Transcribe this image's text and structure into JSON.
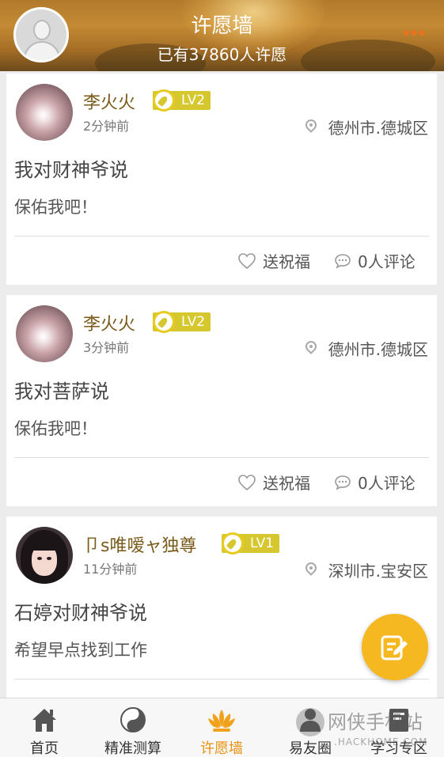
{
  "header": {
    "title": "许愿墙",
    "subtitle": "已有37860人许愿"
  },
  "posts": [
    {
      "user": "李火火",
      "level": "LV2",
      "time": "2分钟前",
      "location": "德州市.德城区",
      "title": "我对财神爷说",
      "content": "保佑我吧！",
      "bless_label": "送祝福",
      "comments_label": "0人评论"
    },
    {
      "user": "李火火",
      "level": "LV2",
      "time": "3分钟前",
      "location": "德州市.德城区",
      "title": "我对菩萨说",
      "content": "保佑我吧！",
      "bless_label": "送祝福",
      "comments_label": "0人评论"
    },
    {
      "user": "卩s唯嗳ャ独尊",
      "level": "LV1",
      "time": "11分钟前",
      "location": "深圳市.宝安区",
      "title": "石婷对财神爷说",
      "content": "希望早点找到工作"
    }
  ],
  "nav": [
    {
      "label": "首页",
      "icon": "home-icon"
    },
    {
      "label": "精准测算",
      "icon": "yin-yang-icon"
    },
    {
      "label": "许愿墙",
      "icon": "lotus-icon",
      "active": true
    },
    {
      "label": "易友圈",
      "icon": "people-icon"
    },
    {
      "label": "学习专区",
      "icon": "book-icon"
    }
  ],
  "watermark": {
    "text": "网侠手机站",
    "url": ".HACKHOME.COM"
  },
  "colors": {
    "accent": "#f6b820",
    "nav_active": "#e8920f",
    "level_badge": "#d6c72e",
    "username": "#7a5a1a"
  }
}
